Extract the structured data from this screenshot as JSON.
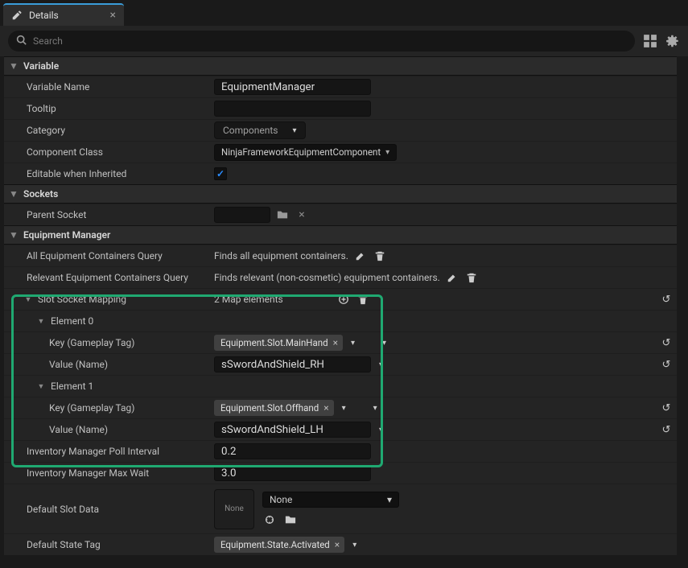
{
  "tab": {
    "title": "Details"
  },
  "search": {
    "placeholder": "Search"
  },
  "sections": {
    "variable": {
      "title": "Variable",
      "variable_name": {
        "label": "Variable Name",
        "value": "EquipmentManager"
      },
      "tooltip": {
        "label": "Tooltip",
        "value": ""
      },
      "category": {
        "label": "Category",
        "value": "Components"
      },
      "component_class": {
        "label": "Component Class",
        "value": "NinjaFrameworkEquipmentComponent"
      },
      "editable_inherited": {
        "label": "Editable when Inherited",
        "checked": true
      }
    },
    "sockets": {
      "title": "Sockets",
      "parent_socket": {
        "label": "Parent Socket",
        "value": ""
      }
    },
    "equipment_manager": {
      "title": "Equipment Manager",
      "all_query": {
        "label": "All Equipment Containers Query",
        "value": "Finds all equipment containers."
      },
      "relevant_query": {
        "label": "Relevant Equipment Containers Query",
        "value": "Finds relevant (non-cosmetic) equipment containers."
      },
      "slot_mapping": {
        "label": "Slot Socket Mapping",
        "summary": "2 Map elements"
      },
      "elements": [
        {
          "header": "Element 0",
          "key_label": "Key (Gameplay Tag)",
          "key_tag": "Equipment.Slot.MainHand",
          "value_label": "Value (Name)",
          "value_name": "sSwordAndShield_RH"
        },
        {
          "header": "Element 1",
          "key_label": "Key (Gameplay Tag)",
          "key_tag": "Equipment.Slot.Offhand",
          "value_label": "Value (Name)",
          "value_name": "sSwordAndShield_LH"
        }
      ],
      "poll_interval": {
        "label": "Inventory Manager Poll Interval",
        "value": "0.2"
      },
      "max_wait": {
        "label": "Inventory Manager Max Wait",
        "value": "3.0"
      },
      "default_slot": {
        "label": "Default Slot Data",
        "thumb": "None",
        "dropdown": "None"
      },
      "default_state": {
        "label": "Default State Tag",
        "tag": "Equipment.State.Activated"
      }
    }
  }
}
